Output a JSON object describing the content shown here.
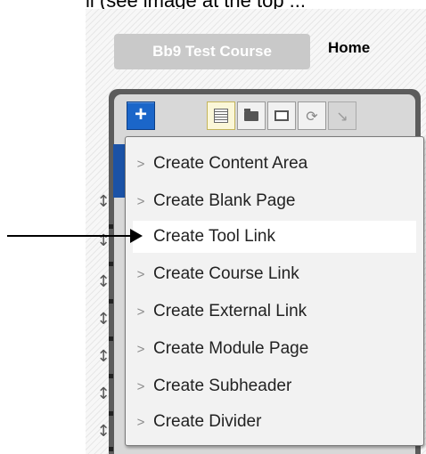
{
  "top_text": "ll (see image at the top ...",
  "course": {
    "name": "Bb9 Test Course",
    "home_label": "Home"
  },
  "toolbar": {
    "add_label": "+",
    "buttons": [
      "list-icon",
      "folder-icon",
      "window-icon",
      "refresh-icon",
      "arrow-down-icon"
    ]
  },
  "menu": {
    "chevron": ">",
    "highlighted_index": 2,
    "items": [
      {
        "label": "Create Content Area"
      },
      {
        "label": "Create Blank Page"
      },
      {
        "label": "Create Tool Link"
      },
      {
        "label": "Create Course Link"
      },
      {
        "label": "Create External Link"
      },
      {
        "label": "Create Module Page"
      },
      {
        "label": "Create Subheader"
      },
      {
        "label": "Create Divider"
      }
    ]
  },
  "colors": {
    "accent_blue": "#1b66c9",
    "course_pill": "#c9c9c9",
    "menu_background": "#f2f2f2",
    "highlight": "#ffffff"
  }
}
